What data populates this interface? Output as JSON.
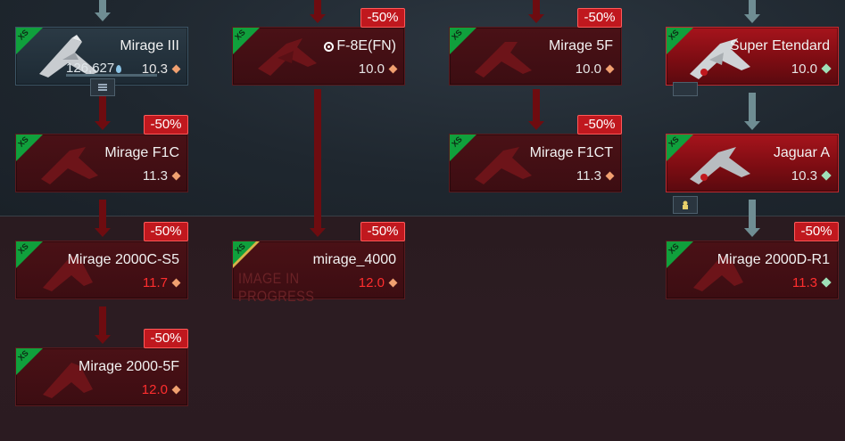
{
  "cards": {
    "mirage3": {
      "name": "Mirage III",
      "exp": "126,627",
      "br": "10.3"
    },
    "f8e": {
      "name": "F-8E(FN)",
      "br": "10.0",
      "discount": "-50%"
    },
    "mirage5f": {
      "name": "Mirage 5F",
      "br": "10.0",
      "discount": "-50%"
    },
    "superetendard": {
      "name": "Super Etendard",
      "br": "10.0"
    },
    "miragef1c": {
      "name": "Mirage F1C",
      "br": "11.3",
      "discount": "-50%"
    },
    "miragef1ct": {
      "name": "Mirage F1CT",
      "br": "11.3",
      "discount": "-50%"
    },
    "jaguara": {
      "name": "Jaguar A",
      "br": "10.3"
    },
    "mirage2000c": {
      "name": "Mirage 2000C-S5",
      "br": "11.7",
      "discount": "-50%"
    },
    "mirage4000": {
      "name": "mirage_4000",
      "br": "12.0",
      "discount": "-50%",
      "placeholder": "IMAGE IN PROGRESS"
    },
    "mirage2000d": {
      "name": "Mirage 2000D-R1",
      "br": "11.3",
      "discount": "-50%"
    },
    "mirage2000_5f": {
      "name": "Mirage 2000-5F",
      "br": "12.0",
      "discount": "-50%"
    }
  },
  "flag_label": "XS",
  "colors": {
    "discount": "#c0181e",
    "br_red": "#ff2e2e",
    "flag_green": "#10a03c",
    "premium_gold": "#d8b24a"
  }
}
